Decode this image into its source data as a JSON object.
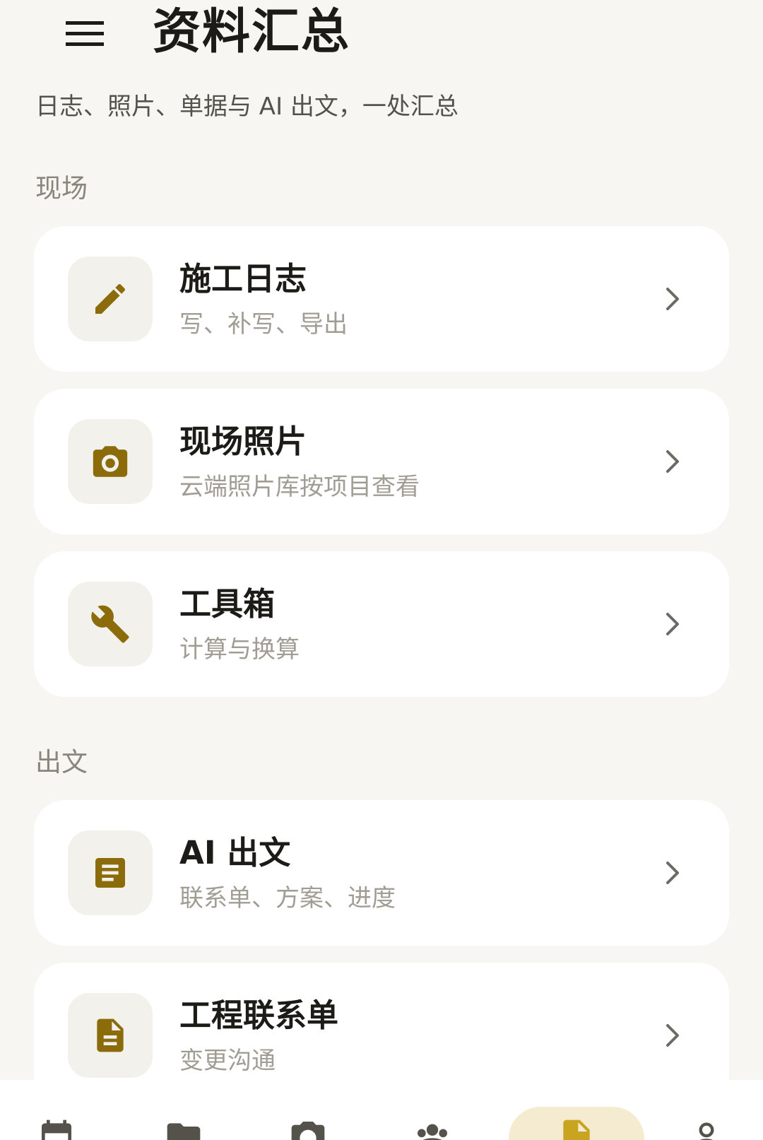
{
  "header": {
    "title": "资料汇总",
    "subtitle": "日志、照片、单据与 AI 出文，一处汇总"
  },
  "sections": [
    {
      "label": "现场",
      "items": [
        {
          "title": "施工日志",
          "desc": "写、补写、导出",
          "icon": "pencil-icon"
        },
        {
          "title": "现场照片",
          "desc": "云端照片库按项目查看",
          "icon": "camera-icon"
        },
        {
          "title": "工具箱",
          "desc": "计算与换算",
          "icon": "wrench-icon"
        }
      ]
    },
    {
      "label": "出文",
      "items": [
        {
          "title": "AI 出文",
          "desc": "联系单、方案、进度",
          "icon": "article-icon"
        },
        {
          "title": "工程联系单",
          "desc": "变更沟通",
          "icon": "file-document-icon"
        }
      ]
    }
  ],
  "bottom_nav": {
    "items": [
      {
        "icon": "calendar-icon",
        "active": false
      },
      {
        "icon": "folder-icon",
        "active": false
      },
      {
        "icon": "camera-icon",
        "active": false
      },
      {
        "icon": "group-icon",
        "active": false
      },
      {
        "icon": "file-document-icon",
        "active": true
      },
      {
        "icon": "person-icon",
        "active": false
      }
    ]
  },
  "colors": {
    "background": "#f7f6f3",
    "card": "#ffffff",
    "icon_tile": "#f3f1ec",
    "accent": "#8b6b0a",
    "accent_active": "#c9a420",
    "active_pill": "#f4ebd0",
    "title_text": "#1d1b17",
    "secondary_text": "#a19d94",
    "section_text": "#8a867d"
  }
}
